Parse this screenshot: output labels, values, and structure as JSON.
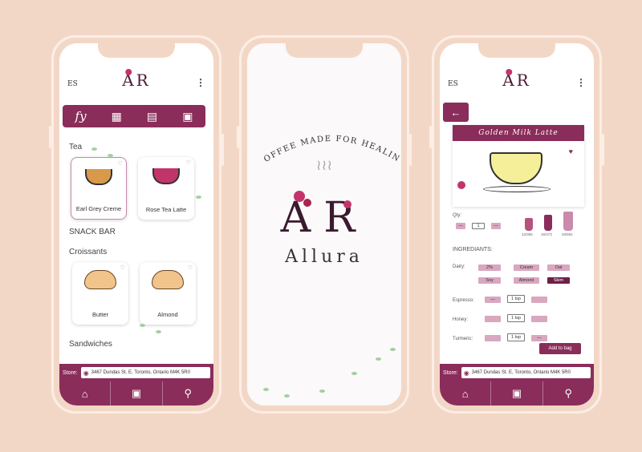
{
  "colors": {
    "background": "#f3d7c6",
    "brand": "#8a2d5a",
    "brand_dark": "#6e1f46",
    "chip": "#d9a7bf"
  },
  "menu_screen": {
    "header": {
      "left_icon": "ES",
      "more_icon": "⋮",
      "logo": "AR"
    },
    "tabs": [
      {
        "name": "for-you-tab",
        "label": "fy"
      },
      {
        "name": "qr-tab",
        "icon": "qr-icon"
      },
      {
        "name": "coffee-tab",
        "icon": "coffee-icon"
      },
      {
        "name": "machine-tab",
        "icon": "machine-icon"
      }
    ],
    "tea": {
      "title": "Tea",
      "items": [
        {
          "label": "Earl Grey Creme"
        },
        {
          "label": "Rose Tea Latte"
        }
      ]
    },
    "snack_bar": {
      "title": "SNACK BAR"
    },
    "croissants": {
      "title": "Croissants",
      "items": [
        {
          "label": "Butter"
        },
        {
          "label": "Almond"
        }
      ]
    },
    "sandwiches": {
      "title": "Sandwiches"
    },
    "store": {
      "label": "Store:",
      "address": "3467 Dundas St. E, Toronto, Ontario M4K 5R0"
    },
    "nav": [
      {
        "icon": "home-icon"
      },
      {
        "icon": "bag-icon"
      },
      {
        "icon": "location-icon"
      }
    ]
  },
  "splash_screen": {
    "tagline": "COFFEE MADE FOR HEALING",
    "logo": "AR",
    "brand": "Allura"
  },
  "detail_screen": {
    "back_label": "←",
    "title": "Golden Milk Latte",
    "qty_label": "Qty:",
    "qty_value": "1",
    "sizes": [
      "12/355",
      "16/473",
      "20/591"
    ],
    "ingredients_label": "INGREDIANTS:",
    "dairy_label": "Dairy:",
    "dairy_options": [
      "2%",
      "Cream",
      "Oat",
      "Soy",
      "Almond",
      "Skim"
    ],
    "espresso_label": "Espresso:",
    "espresso_value": "1 tsp",
    "honey_label": "Honey:",
    "honey_value": "1 tsp",
    "turmeric_label": "Turmeric:",
    "turmeric_value": "1 tsp",
    "add_to_bag": "Add to bag",
    "store": {
      "label": "Store:",
      "address": "3467 Dundas St. E, Toronto, Ontario M4K 5R0"
    },
    "nav": [
      {
        "icon": "home-icon"
      },
      {
        "icon": "bag-icon"
      },
      {
        "icon": "location-icon"
      }
    ]
  }
}
